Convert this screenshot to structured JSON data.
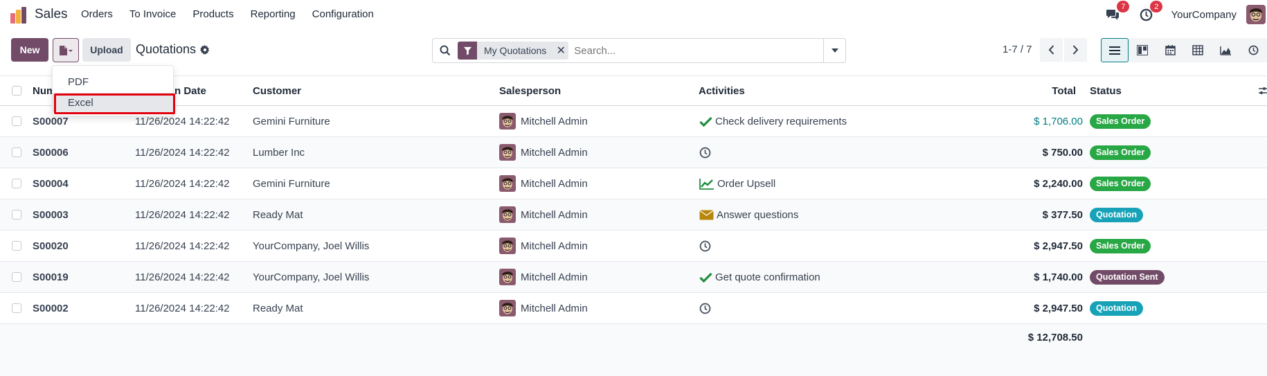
{
  "navbar": {
    "app_name": "Sales",
    "menu": [
      "Orders",
      "To Invoice",
      "Products",
      "Reporting",
      "Configuration"
    ],
    "messages_badge": "7",
    "activities_badge": "2",
    "company": "YourCompany"
  },
  "control": {
    "new_label": "New",
    "upload_label": "Upload",
    "breadcrumb": "Quotations",
    "facet_label": "My Quotations",
    "search_placeholder": "Search...",
    "pager": "1-7 / 7"
  },
  "dropdown": {
    "items": [
      "PDF",
      "Excel"
    ]
  },
  "table": {
    "columns": {
      "number": "Num",
      "date": "n Date",
      "customer": "Customer",
      "salesperson": "Salesperson",
      "activities": "Activities",
      "total": "Total",
      "status": "Status"
    },
    "rows": [
      {
        "number": "S00007",
        "date": "11/26/2024 14:22:42",
        "customer": "Gemini Furniture",
        "salesperson": "Mitchell Admin",
        "activity_icon": "check-icon",
        "activity": "Check delivery requirements",
        "total": "$ 1,706.00",
        "status": "Sales Order"
      },
      {
        "number": "S00006",
        "date": "11/26/2024 14:22:42",
        "customer": "Lumber Inc",
        "salesperson": "Mitchell Admin",
        "activity_icon": "clock-icon",
        "activity": "",
        "total": "$ 750.00",
        "status": "Sales Order"
      },
      {
        "number": "S00004",
        "date": "11/26/2024 14:22:42",
        "customer": "Gemini Furniture",
        "salesperson": "Mitchell Admin",
        "activity_icon": "chart-line-icon",
        "activity": "Order Upsell",
        "total": "$ 2,240.00",
        "status": "Sales Order"
      },
      {
        "number": "S00003",
        "date": "11/26/2024 14:22:42",
        "customer": "Ready Mat",
        "salesperson": "Mitchell Admin",
        "activity_icon": "envelope-icon",
        "activity": "Answer questions",
        "total": "$ 377.50",
        "status": "Quotation"
      },
      {
        "number": "S00020",
        "date": "11/26/2024 14:22:42",
        "customer": "YourCompany, Joel Willis",
        "salesperson": "Mitchell Admin",
        "activity_icon": "clock-icon",
        "activity": "",
        "total": "$ 2,947.50",
        "status": "Sales Order"
      },
      {
        "number": "S00019",
        "date": "11/26/2024 14:22:42",
        "customer": "YourCompany, Joel Willis",
        "salesperson": "Mitchell Admin",
        "activity_icon": "check-icon",
        "activity": "Get quote confirmation",
        "total": "$ 1,740.00",
        "status": "Quotation Sent"
      },
      {
        "number": "S00002",
        "date": "11/26/2024 14:22:42",
        "customer": "Ready Mat",
        "salesperson": "Mitchell Admin",
        "activity_icon": "clock-icon",
        "activity": "",
        "total": "$ 2,947.50",
        "status": "Quotation"
      }
    ],
    "grand_total": "$ 12,708.50"
  },
  "colors": {
    "brand": "#714b67",
    "accent": "#017e84",
    "sales_order": "#28a745",
    "quotation": "#17a2b8",
    "quotation_sent": "#714b67",
    "highlight": "#e3000f"
  }
}
